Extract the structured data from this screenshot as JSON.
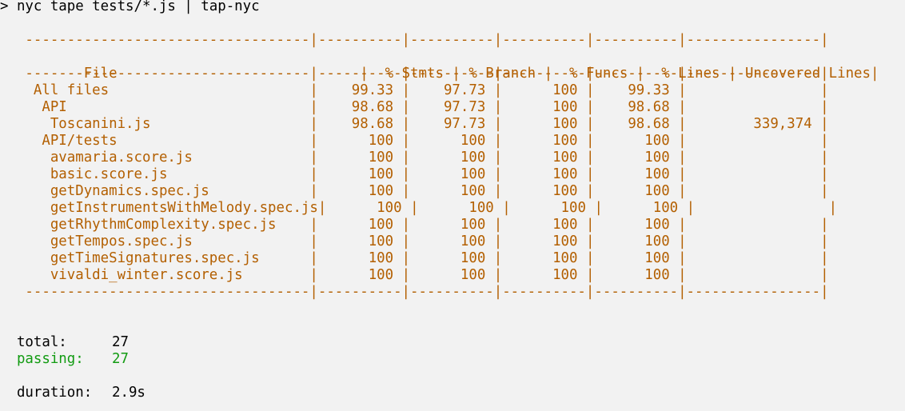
{
  "command": "> nyc tape tests/*.js | tap-nyc",
  "coverage": {
    "separator": "   ----------------------------------|----------|----------|----------|----------|----------------|",
    "columns": [
      "File",
      "% Stmts",
      "% Branch",
      "% Funcs",
      "% Lines",
      "Uncovered Lines"
    ],
    "rows": [
      {
        "file": "All files",
        "indent": 0,
        "stmts": "99.33",
        "branch": "97.73",
        "funcs": "100",
        "lines": "99.33",
        "uncovered": ""
      },
      {
        "file": "API",
        "indent": 1,
        "stmts": "98.68",
        "branch": "97.73",
        "funcs": "100",
        "lines": "98.68",
        "uncovered": ""
      },
      {
        "file": "Toscanini.js",
        "indent": 2,
        "stmts": "98.68",
        "branch": "97.73",
        "funcs": "100",
        "lines": "98.68",
        "uncovered": "339,374"
      },
      {
        "file": "API/tests",
        "indent": 1,
        "stmts": "100",
        "branch": "100",
        "funcs": "100",
        "lines": "100",
        "uncovered": ""
      },
      {
        "file": "avamaria.score.js",
        "indent": 2,
        "stmts": "100",
        "branch": "100",
        "funcs": "100",
        "lines": "100",
        "uncovered": ""
      },
      {
        "file": "basic.score.js",
        "indent": 2,
        "stmts": "100",
        "branch": "100",
        "funcs": "100",
        "lines": "100",
        "uncovered": ""
      },
      {
        "file": "getDynamics.spec.js",
        "indent": 2,
        "stmts": "100",
        "branch": "100",
        "funcs": "100",
        "lines": "100",
        "uncovered": ""
      },
      {
        "file": "getInstrumentsWithMelody.spec.js",
        "indent": 2,
        "stmts": "100",
        "branch": "100",
        "funcs": "100",
        "lines": "100",
        "uncovered": ""
      },
      {
        "file": "getRhythmComplexity.spec.js",
        "indent": 2,
        "stmts": "100",
        "branch": "100",
        "funcs": "100",
        "lines": "100",
        "uncovered": ""
      },
      {
        "file": "getTempos.spec.js",
        "indent": 2,
        "stmts": "100",
        "branch": "100",
        "funcs": "100",
        "lines": "100",
        "uncovered": ""
      },
      {
        "file": "getTimeSignatures.spec.js",
        "indent": 2,
        "stmts": "100",
        "branch": "100",
        "funcs": "100",
        "lines": "100",
        "uncovered": ""
      },
      {
        "file": "vivaldi_winter.score.js",
        "indent": 2,
        "stmts": "100",
        "branch": "100",
        "funcs": "100",
        "lines": "100",
        "uncovered": ""
      }
    ]
  },
  "summary": {
    "total_label": "  total:",
    "total_value": "27",
    "passing_label": "  passing:",
    "passing_value": "27",
    "duration_label": "  duration:",
    "duration_value": "2.9s"
  },
  "colors": {
    "background": "#f2f2f2",
    "coverage_text": "#b35f00",
    "passing": "#129b12",
    "text": "#000000"
  }
}
